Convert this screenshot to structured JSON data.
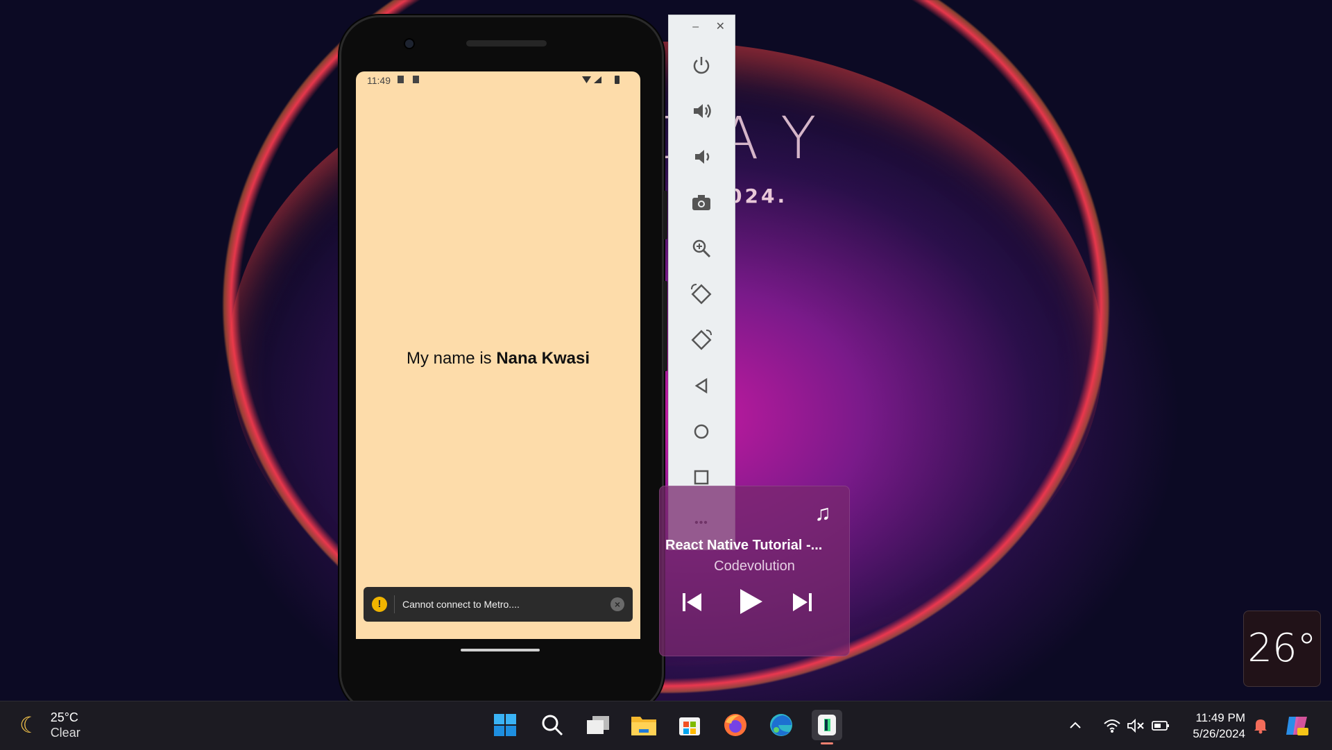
{
  "wallpaper": {
    "big_text": "DAY",
    "year_text": "024.",
    "dash_text": "- -"
  },
  "phone": {
    "status_time": "11:49",
    "name_prefix": "My name is ",
    "name_bold": "Nana Kwasi",
    "toast_message": "Cannot connect to Metro....",
    "toast_warn_glyph": "!",
    "toast_close_glyph": "×"
  },
  "emulator_toolbar": {
    "minimize_glyph": "–",
    "close_glyph": "✕",
    "buttons": [
      "power-icon",
      "volume-up-icon",
      "volume-down-icon",
      "camera-icon",
      "zoom-icon",
      "rotate-left-icon",
      "rotate-right-icon",
      "back-icon",
      "home-icon",
      "overview-icon",
      "more-icon"
    ],
    "more_glyph": "•••"
  },
  "media": {
    "title": "React Native Tutorial -...",
    "artist": "Codevolution",
    "note_glyph": "♫"
  },
  "temperature_widget": "26°",
  "taskbar": {
    "weather_temp": "25°C",
    "weather_cond": "Clear",
    "clock_time": "11:49 PM",
    "clock_date": "5/26/2024",
    "apps": [
      "start-icon",
      "search-icon",
      "task-view-icon",
      "file-explorer-icon",
      "store-icon",
      "firefox-icon",
      "edge-icon",
      "android-studio-icon"
    ]
  },
  "colors": {
    "screen_bg": "#fddcaa",
    "toast_bg": "#2b2b2b",
    "warn": "#f0b400",
    "taskbar_bg": "#1c1b22"
  }
}
